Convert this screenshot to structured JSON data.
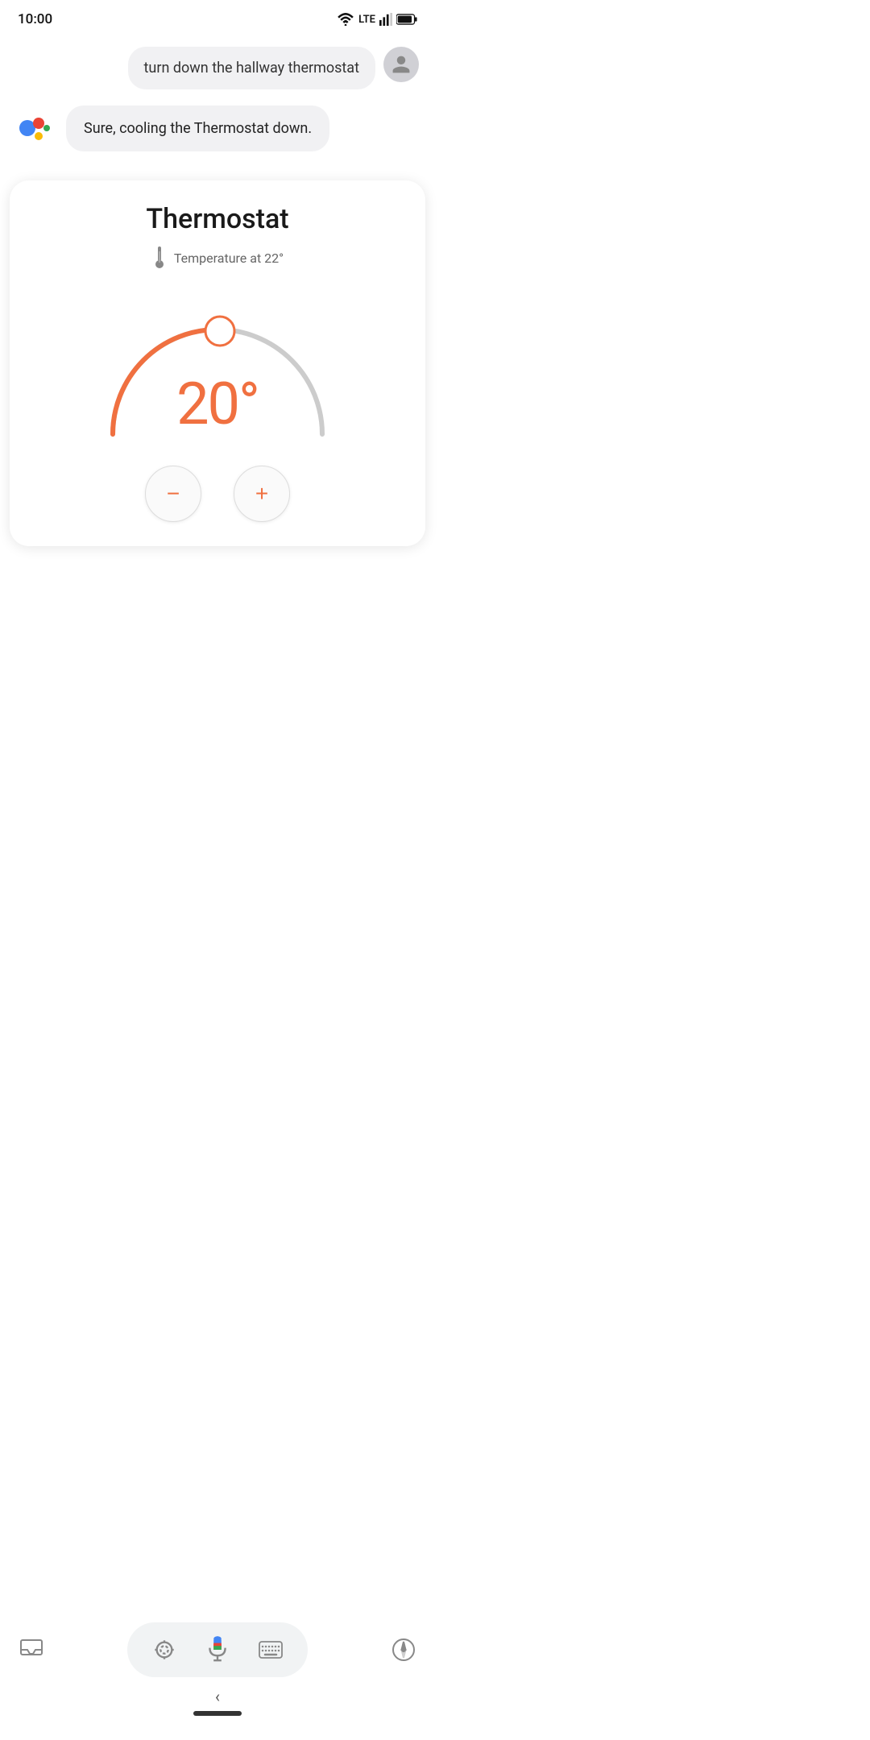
{
  "statusBar": {
    "time": "10:00"
  },
  "userMessage": {
    "text": "turn down the hallway thermostat"
  },
  "assistantMessage": {
    "text": "Sure, cooling the Thermostat down."
  },
  "thermostat": {
    "title": "Thermostat",
    "tempLabel": "Temperature at 22°",
    "currentTemp": "20°",
    "colors": {
      "active": "#f07040",
      "inactive": "#cccccc"
    }
  },
  "controls": {
    "decrease": "−",
    "increase": "+"
  }
}
